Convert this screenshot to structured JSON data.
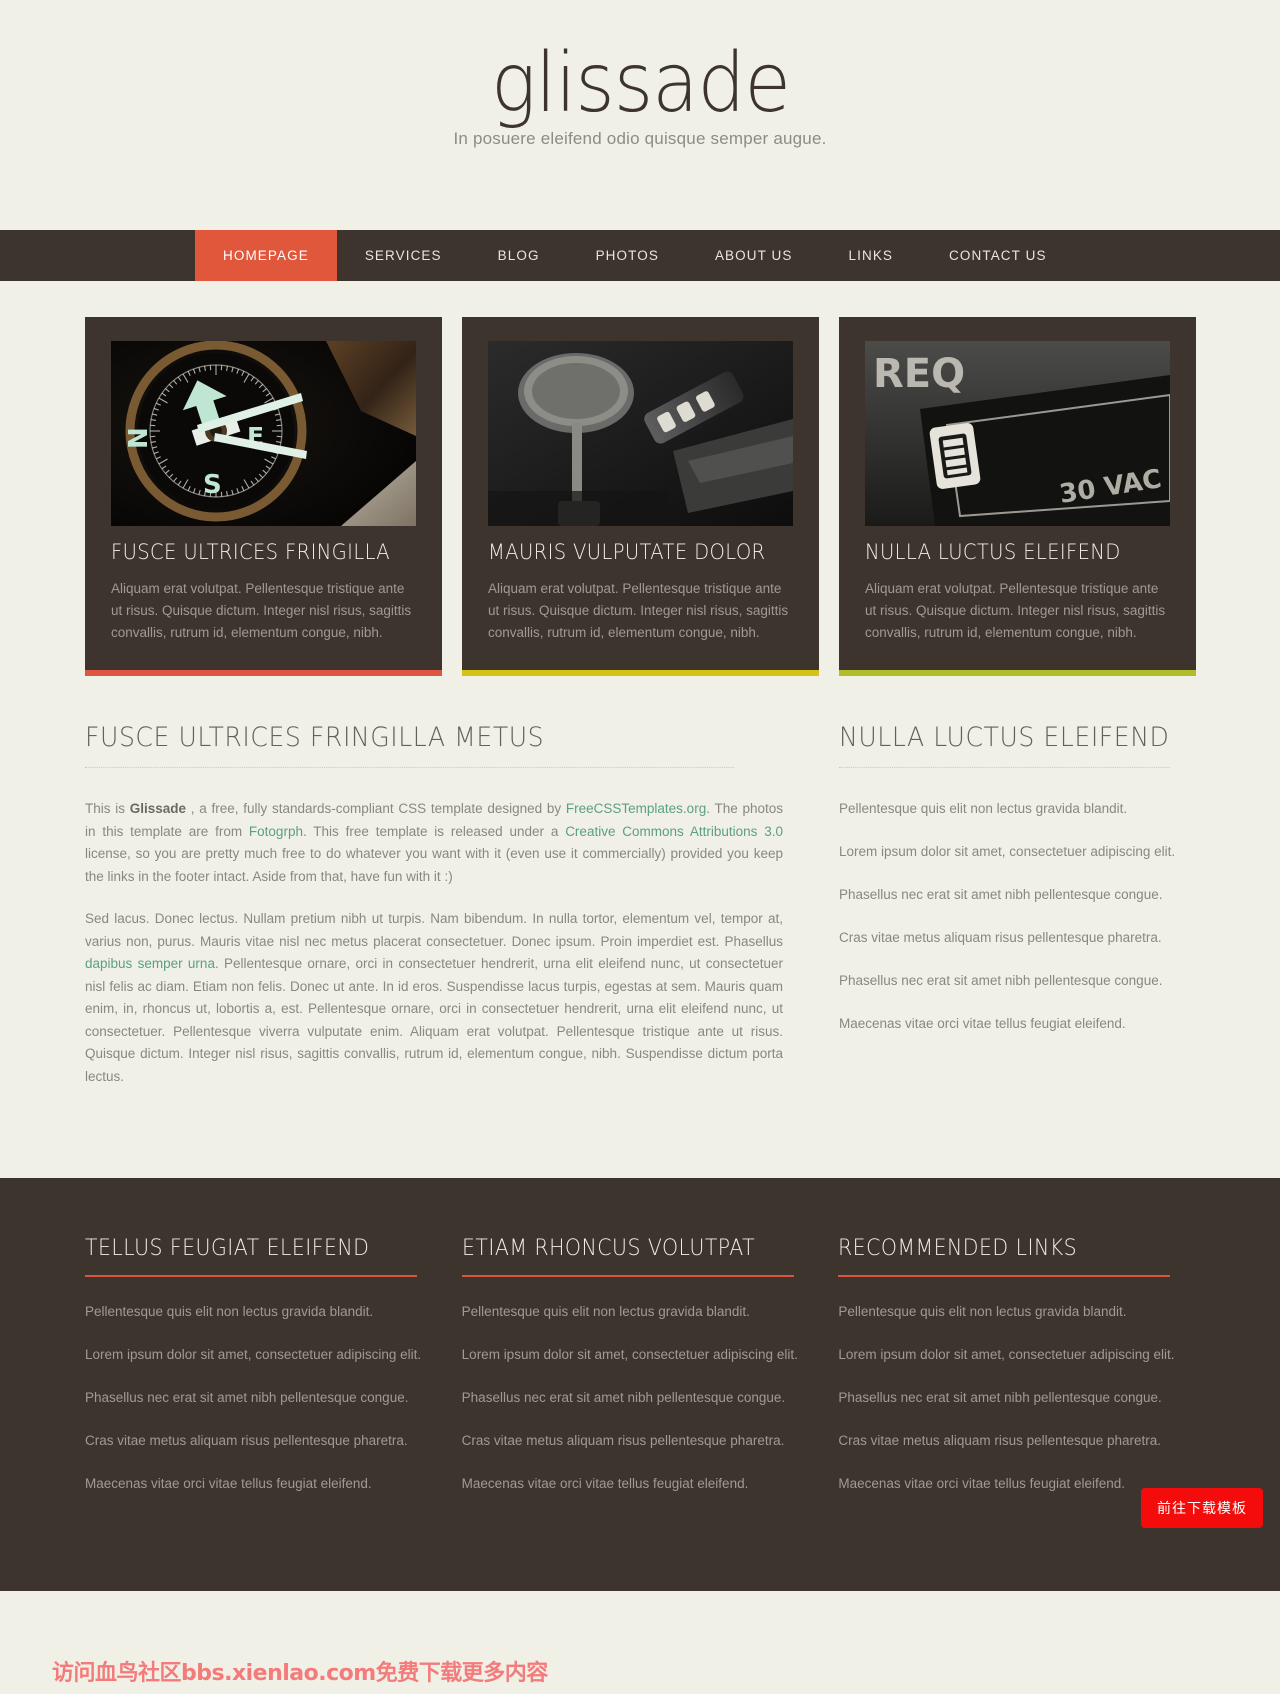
{
  "colors": {
    "page_bg": "#f0f0e6",
    "dark": "#3d342e",
    "accent_orange": "#e0573c",
    "link_green": "#5ba081",
    "strip_red": "#de5543",
    "strip_yellow": "#d4c217",
    "strip_olive": "#b0bc2a",
    "button_red": "#f40b0b",
    "watermark_pink": "#f47b7b"
  },
  "header": {
    "logo": "glissade",
    "tagline": "In posuere eleifend odio quisque semper augue."
  },
  "nav": {
    "items": [
      {
        "label": "HOMEPAGE",
        "active": true
      },
      {
        "label": "SERVICES",
        "active": false
      },
      {
        "label": "BLOG",
        "active": false
      },
      {
        "label": "PHOTOS",
        "active": false
      },
      {
        "label": "ABOUT US",
        "active": false
      },
      {
        "label": "LINKS",
        "active": false
      },
      {
        "label": "CONTACT US",
        "active": false
      }
    ]
  },
  "boxes": [
    {
      "image_name": "compass-photo",
      "title": "FUSCE ULTRICES FRINGILLA",
      "text": "Aliquam erat volutpat. Pellentesque tristique ante ut risus. Quisque dictum. Integer nisl risus, sagittis convallis, rutrum id, elementum congue, nibh.",
      "strip_color": "#de5543"
    },
    {
      "image_name": "macro-machine-photo",
      "title": "MAURIS VULPUTATE DOLOR",
      "text": "Aliquam erat volutpat. Pellentesque tristique ante ut risus. Quisque dictum. Integer nisl risus, sagittis convallis, rutrum id, elementum congue, nibh.",
      "strip_color": "#d4c217"
    },
    {
      "image_name": "switch-panel-photo",
      "title": "NULLA LUCTUS ELEIFEND",
      "text": "Aliquam erat volutpat. Pellentesque tristique ante ut risus. Quisque dictum. Integer nisl risus, sagittis convallis, rutrum id, elementum congue, nibh.",
      "strip_color": "#b0bc2a"
    }
  ],
  "content": {
    "title": "FUSCE ULTRICES FRINGILLA METUS",
    "p1": {
      "t1": "This is ",
      "b1": "Glissade",
      "t2": " , a free, fully standards-compliant CSS template designed by ",
      "a1": "FreeCSSTemplates.org",
      "t3": ". The photos in this template are from ",
      "a2": "Fotogrph",
      "t4": ". This free template is released under a ",
      "a3": "Creative Commons Attributions 3.0",
      "t5": " license, so you are pretty much free to do whatever you want with it (even use it commercially) provided you keep the links in the footer intact. Aside from that, have fun with it :)"
    },
    "p2": {
      "t1": "Sed lacus. Donec lectus. Nullam pretium nibh ut turpis. Nam bibendum. In nulla tortor, elementum vel, tempor at, varius non, purus. Mauris vitae nisl nec metus placerat consectetuer. Donec ipsum. Proin imperdiet est. Phasellus ",
      "a1": "dapibus semper urna",
      "t2": ". Pellentesque ornare, orci in consectetuer hendrerit, urna elit eleifend nunc, ut consectetuer nisl felis ac diam. Etiam non felis. Donec ut ante. In id eros. Suspendisse lacus turpis, egestas at sem. Mauris quam enim, in, rhoncus ut, lobortis a, est. Pellentesque ornare, orci in consectetuer hendrerit, urna elit eleifend nunc, ut consectetuer. Pellentesque viverra vulputate enim. Aliquam erat volutpat. Pellentesque tristique ante ut risus. Quisque dictum. Integer nisl risus, sagittis convallis, rutrum id, elementum congue, nibh. Suspendisse dictum porta lectus."
    }
  },
  "sidebar": {
    "title": "NULLA LUCTUS ELEIFEND",
    "items": [
      "Pellentesque quis elit non lectus gravida blandit.",
      "Lorem ipsum dolor sit amet, consectetuer adipiscing elit.",
      "Phasellus nec erat sit amet nibh pellentesque congue.",
      "Cras vitae metus aliquam risus pellentesque pharetra.",
      "Phasellus nec erat sit amet nibh pellentesque congue.",
      "Maecenas vitae orci vitae tellus feugiat eleifend."
    ]
  },
  "footer": {
    "columns": [
      {
        "title": "TELLUS FEUGIAT ELEIFEND",
        "items": [
          "Pellentesque quis elit non lectus gravida blandit.",
          "Lorem ipsum dolor sit amet, consectetuer adipiscing elit.",
          "Phasellus nec erat sit amet nibh pellentesque congue.",
          "Cras vitae metus aliquam risus pellentesque pharetra.",
          "Maecenas vitae orci vitae tellus feugiat eleifend."
        ]
      },
      {
        "title": "ETIAM RHONCUS VOLUTPAT",
        "items": [
          "Pellentesque quis elit non lectus gravida blandit.",
          "Lorem ipsum dolor sit amet, consectetuer adipiscing elit.",
          "Phasellus nec erat sit amet nibh pellentesque congue.",
          "Cras vitae metus aliquam risus pellentesque pharetra.",
          "Maecenas vitae orci vitae tellus feugiat eleifend."
        ]
      },
      {
        "title": "RECOMMENDED LINKS",
        "items": [
          "Pellentesque quis elit non lectus gravida blandit.",
          "Lorem ipsum dolor sit amet, consectetuer adipiscing elit.",
          "Phasellus nec erat sit amet nibh pellentesque congue.",
          "Cras vitae metus aliquam risus pellentesque pharetra.",
          "Maecenas vitae orci vitae tellus feugiat eleifend."
        ]
      }
    ]
  },
  "overlay": {
    "download_button": "前往下载模板",
    "watermark": "访问血鸟社区bbs.xienlao.com免费下载更多内容"
  }
}
